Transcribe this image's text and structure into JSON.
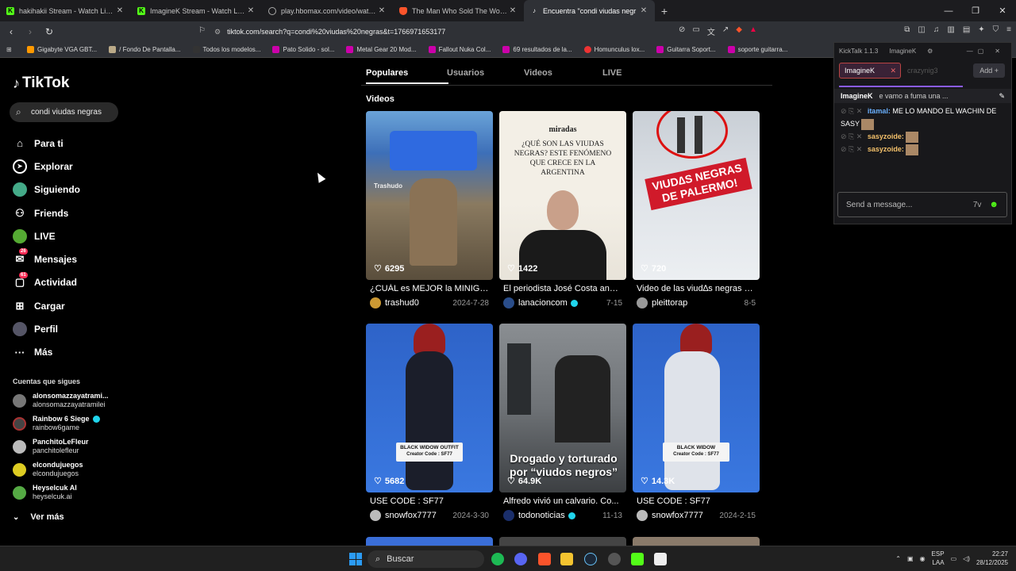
{
  "browser": {
    "tabs": [
      {
        "title": "hakihakii Stream - Watch Live on",
        "icon": "kick-icon",
        "color": "#53fc18"
      },
      {
        "title": "ImagineK Stream - Watch Live on",
        "icon": "kick-icon",
        "color": "#53fc18"
      },
      {
        "title": "play.hbomax.com/video/watch/ae3",
        "icon": "globe-icon",
        "color": "#888888"
      },
      {
        "title": "The Man Who Sold The World (acco",
        "icon": "brave-icon",
        "color": "#fb542b"
      },
      {
        "title": "Encuentra \"condi viudas negr",
        "icon": "tiktok-icon",
        "color": "#ffffff",
        "active": true
      }
    ],
    "url": "tiktok.com/search?q=condi%20viudas%20negras&t=1766971653177",
    "bookmarks": [
      "Gigabyte VGA GBT...",
      "/ Fondo De Pantalla...",
      "Todos los modelos...",
      "Pato Solido - sol...",
      "Metal Gear 20 Mod...",
      "Fallout Nuka Col...",
      "69 resultados de la...",
      "Homunculus lox...",
      "Guitarra Soport...",
      "soporte guitarra..."
    ]
  },
  "sidebar": {
    "logo": "TikTok",
    "search_value": "condi viudas negras",
    "items": [
      {
        "label": "Para ti",
        "icon": "home-icon"
      },
      {
        "label": "Explorar",
        "icon": "compass-icon"
      },
      {
        "label": "Siguiendo",
        "icon": "following-icon"
      },
      {
        "label": "Friends",
        "icon": "friends-icon"
      },
      {
        "label": "LIVE",
        "icon": "live-icon"
      },
      {
        "label": "Mensajes",
        "icon": "messages-icon",
        "badge": "26"
      },
      {
        "label": "Actividad",
        "icon": "activity-icon",
        "badge": "61"
      },
      {
        "label": "Cargar",
        "icon": "upload-icon"
      },
      {
        "label": "Perfil",
        "icon": "profile-icon"
      },
      {
        "label": "Más",
        "icon": "more-icon"
      }
    ],
    "following_header": "Cuentas que sigues",
    "following": [
      {
        "name": "alonsomazzayatrami...",
        "handle": "alonsomazzayatramilei"
      },
      {
        "name": "Rainbow 6 Siege",
        "handle": "rainbow6game",
        "verified": true
      },
      {
        "name": "PanchitoLeFleur",
        "handle": "panchitolefleur"
      },
      {
        "name": "elcondujuegos",
        "handle": "elcondujuegos"
      },
      {
        "name": "Heyselcuk AI",
        "handle": "heyselcuk.ai"
      }
    ],
    "see_more": "Ver más"
  },
  "results": {
    "tabs": [
      "Populares",
      "Usuarios",
      "Videos",
      "LIVE"
    ],
    "section_title": "Videos",
    "videos": [
      {
        "likes": "6295",
        "title": "¿CUÁL es MEJOR la MINIGU...",
        "author": "trashud0",
        "date": "2024-7-28",
        "verified": false,
        "overlay": "Trashudo"
      },
      {
        "likes": "1422",
        "title": "El periodista José Costa anal...",
        "author": "lanacioncom",
        "date": "7-15",
        "verified": true,
        "overlay": "miradas",
        "overlay2": "¿QUÉ SON LAS VIUDAS NEGRAS? ESTE FENÓMENO QUE CRECE EN LA ARGENTINA"
      },
      {
        "likes": "720",
        "title": "Video de las viud∆s negras e...",
        "author": "pleittorap",
        "date": "8-5",
        "verified": false,
        "overlay": "VIUD∆S NEGRAS DE PALERMO!"
      },
      {
        "likes": "5682",
        "title": "USE CODE : SF77",
        "author": "snowfox7777",
        "date": "2024-3-30",
        "verified": false,
        "overlay": "BLACK WIDOW OUTFIT",
        "overlay2": "Creator Code : SF77"
      },
      {
        "likes": "64.9K",
        "title": "Alfredo vivió un calvario. Co...",
        "author": "todonoticias",
        "date": "11-13",
        "verified": true,
        "overlay": "Drogado y torturado por “viudos negros”"
      },
      {
        "likes": "14.3K",
        "title": "USE CODE : SF77",
        "author": "snowfox7777",
        "date": "2024-2-15",
        "verified": false,
        "overlay": "BLACK WIDOW",
        "overlay2": "Creator Code : SF77"
      }
    ]
  },
  "kicktalk": {
    "title": "KickTalk 1.1.3",
    "user": "ImagineK",
    "channels": [
      "ImagineK",
      "crazynig3"
    ],
    "add_label": "Add",
    "pinned": {
      "user": "ImagineK",
      "text": "e vamo a fuma una ..."
    },
    "messages": [
      {
        "user": "itamal",
        "text": "ME LO MANDO EL WACHIN DE SASY"
      },
      {
        "user": "sasyzoide",
        "text": ""
      },
      {
        "user": "sasyzoide",
        "text": ""
      }
    ],
    "input_placeholder": "Send a message..."
  },
  "taskbar": {
    "search_label": "Buscar",
    "lang": "ESP",
    "region": "LAA",
    "time": "22:27",
    "date": "28/12/2025"
  }
}
